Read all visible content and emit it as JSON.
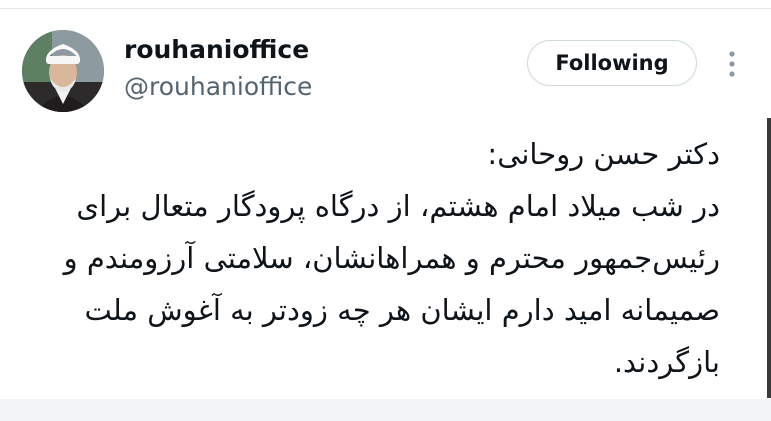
{
  "tweet": {
    "display_name": "rouhanioffice",
    "handle": "@rouhanioffice",
    "follow_label": "Following",
    "avatar_icon": "profile-photo",
    "more_icon": "more-options-icon",
    "lines": [
      "دکتر حسن روحانی:",
      "در شب میلاد امام هشتم، از درگاه پرودگار متعال برای",
      "رئیس‌جمهور محترم و همراهانشان، سلامتی آرزومندم و",
      "صمیمانه امید دارم ایشان هر چه زودتر به آغوش ملت",
      "بازگردند."
    ]
  },
  "colors": {
    "text_primary": "#0f1419",
    "text_secondary": "#536471",
    "button_border": "#cfd9de"
  }
}
